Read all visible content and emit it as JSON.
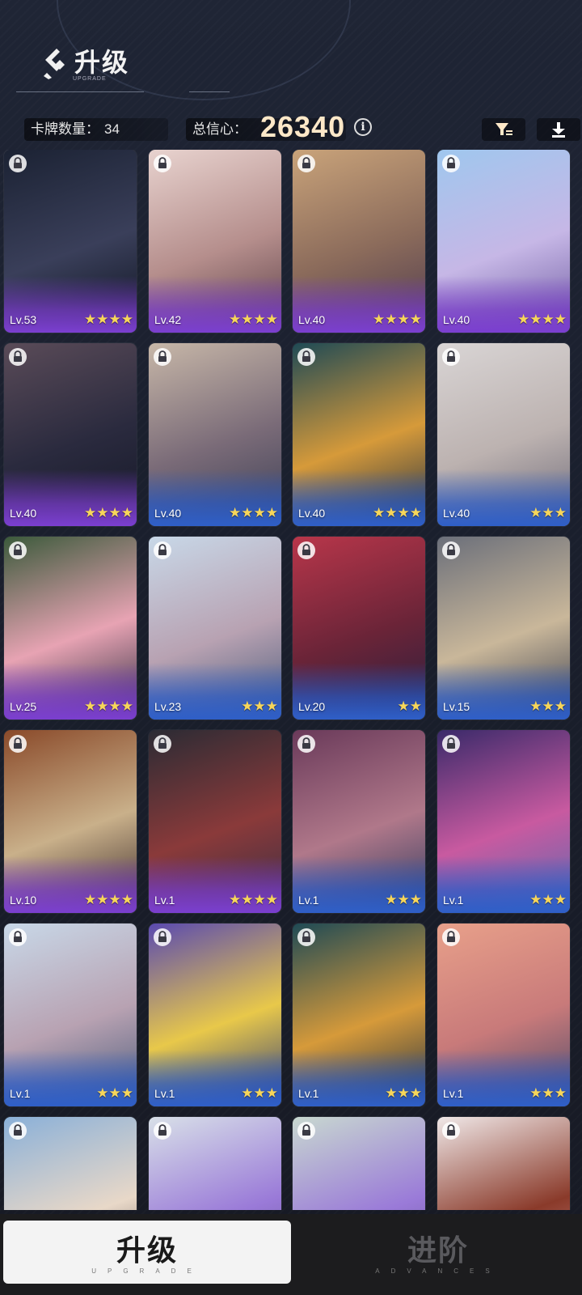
{
  "header": {
    "title": "升级",
    "subtitle": "UPGRADE"
  },
  "stats": {
    "card_count_label": "卡牌数量：",
    "card_count": "34",
    "total_label": "总信心：",
    "total_value": "26340"
  },
  "cards": [
    {
      "level": "Lv.53",
      "stars": "★★★★",
      "rarity": "purple",
      "art": [
        "#1b2233",
        "#3a3f5a",
        "#0e1320"
      ]
    },
    {
      "level": "Lv.42",
      "stars": "★★★★",
      "rarity": "purple",
      "art": [
        "#e8d3cf",
        "#b58e8c",
        "#5a3e46"
      ]
    },
    {
      "level": "Lv.40",
      "stars": "★★★★",
      "rarity": "purple",
      "art": [
        "#c9a37a",
        "#8b6b5b",
        "#4e3a4e"
      ]
    },
    {
      "level": "Lv.40",
      "stars": "★★★★",
      "rarity": "purple",
      "art": [
        "#9fc7ee",
        "#c6b7e6",
        "#6e5aa0"
      ]
    },
    {
      "level": "Lv.40",
      "stars": "★★★★",
      "rarity": "purple",
      "art": [
        "#5a4b58",
        "#2a2a3e",
        "#151827"
      ]
    },
    {
      "level": "Lv.40",
      "stars": "★★★★",
      "rarity": "blue",
      "art": [
        "#c7b7a8",
        "#7a6b78",
        "#3c3f55"
      ]
    },
    {
      "level": "Lv.40",
      "stars": "★★★★",
      "rarity": "blue",
      "art": [
        "#1f4a55",
        "#d69a3a",
        "#213043"
      ]
    },
    {
      "level": "Lv.40",
      "stars": "★★★",
      "rarity": "blue",
      "art": [
        "#d9d5d5",
        "#bcb2b0",
        "#6e6a78"
      ]
    },
    {
      "level": "Lv.25",
      "stars": "★★★★",
      "rarity": "purple",
      "art": [
        "#3b5a3b",
        "#e7a3b3",
        "#2b2b3f"
      ]
    },
    {
      "level": "Lv.23",
      "stars": "★★★",
      "rarity": "blue",
      "art": [
        "#c8d8e8",
        "#b8a2b2",
        "#4a5a7a"
      ]
    },
    {
      "level": "Lv.20",
      "stars": "★★",
      "rarity": "blue",
      "art": [
        "#b8364a",
        "#6a2438",
        "#2a1f3e"
      ]
    },
    {
      "level": "Lv.15",
      "stars": "★★★",
      "rarity": "blue",
      "art": [
        "#6b6f7a",
        "#c9b79a",
        "#3a3e4e"
      ]
    },
    {
      "level": "Lv.10",
      "stars": "★★★★",
      "rarity": "purple",
      "art": [
        "#8a4a2a",
        "#c9b08a",
        "#3a2a2a"
      ]
    },
    {
      "level": "Lv.1",
      "stars": "★★★★",
      "rarity": "purple",
      "art": [
        "#2b2b34",
        "#8a3a3a",
        "#3a2e44"
      ]
    },
    {
      "level": "Lv.1",
      "stars": "★★★",
      "rarity": "blue",
      "art": [
        "#6a3a5a",
        "#b0788a",
        "#2e3a5e"
      ]
    },
    {
      "level": "Lv.1",
      "stars": "★★★",
      "rarity": "blue",
      "art": [
        "#3a2a6a",
        "#c85aa0",
        "#5a6ab0"
      ]
    },
    {
      "level": "Lv.1",
      "stars": "★★★",
      "rarity": "blue",
      "art": [
        "#c8d8e8",
        "#b8a2b2",
        "#4a5a7a"
      ]
    },
    {
      "level": "Lv.1",
      "stars": "★★★",
      "rarity": "blue",
      "art": [
        "#5a4ab0",
        "#e8c84a",
        "#2e3a7a"
      ]
    },
    {
      "level": "Lv.1",
      "stars": "★★★",
      "rarity": "blue",
      "art": [
        "#1f4a55",
        "#d69a3a",
        "#213043"
      ]
    },
    {
      "level": "Lv.1",
      "stars": "★★★",
      "rarity": "blue",
      "art": [
        "#e8a08a",
        "#c87a7a",
        "#4a4a6a"
      ]
    },
    {
      "level": "",
      "stars": "",
      "rarity": "blue",
      "art": [
        "#8ab0d8",
        "#e8d8c8",
        "#4a3a3a"
      ]
    },
    {
      "level": "",
      "stars": "",
      "rarity": "blue",
      "art": [
        "#d8e0e8",
        "#9a7ad8",
        "#5a4a8a"
      ]
    },
    {
      "level": "",
      "stars": "",
      "rarity": "blue",
      "art": [
        "#c8d8d0",
        "#9a7ad8",
        "#5a4a8a"
      ]
    },
    {
      "level": "",
      "stars": "",
      "rarity": "blue",
      "art": [
        "#f0e8e8",
        "#8a3a2a",
        "#d89a9a"
      ]
    }
  ],
  "tabs": {
    "upgrade_label": "升级",
    "upgrade_sub": "UPGRADE",
    "advance_label": "进阶",
    "advance_sub": "ADVANCES"
  },
  "colors": {
    "star": "#f7d65a",
    "total_value": "#fde8c8",
    "active_tab_bg": "#f3f3f3"
  }
}
